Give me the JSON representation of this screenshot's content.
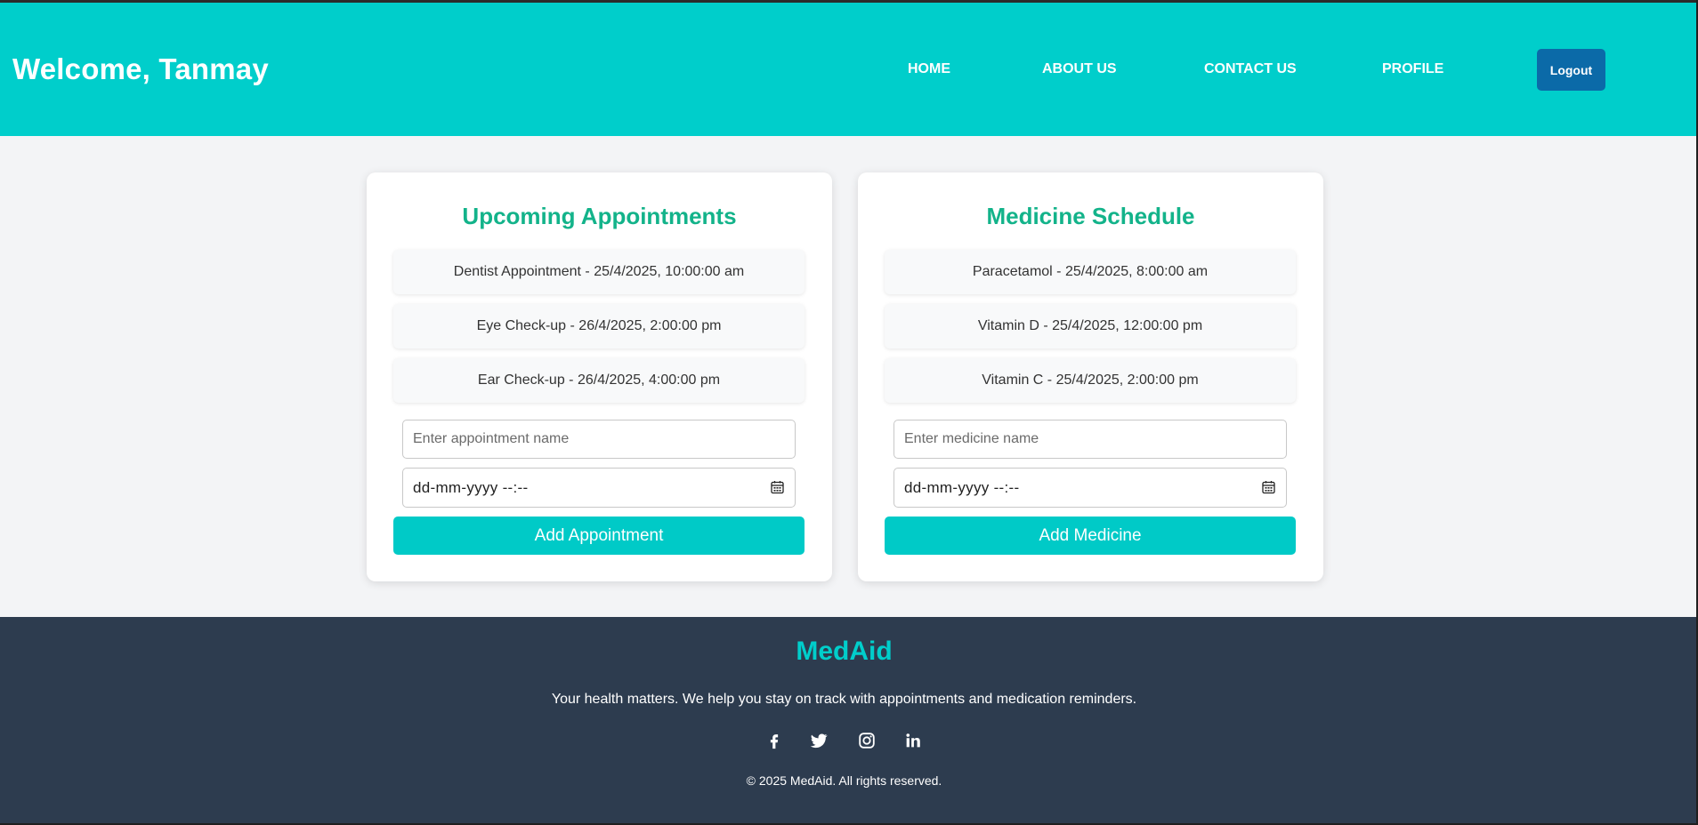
{
  "header": {
    "welcome": "Welcome, Tanmay",
    "nav": {
      "home": "HOME",
      "about": "ABOUT US",
      "contact": "CONTACT US",
      "profile": "PROFILE"
    },
    "logout_label": "Logout"
  },
  "appointments": {
    "title": "Upcoming Appointments",
    "items": [
      "Dentist Appointment - 25/4/2025, 10:00:00 am",
      "Eye Check-up - 26/4/2025, 2:00:00 pm",
      "Ear Check-up - 26/4/2025, 4:00:00 pm"
    ],
    "name_placeholder": "Enter appointment name",
    "name_value": "",
    "date_placeholder": "dd-mm-yyyy --:--",
    "button_label": "Add Appointment"
  },
  "medicines": {
    "title": "Medicine Schedule",
    "items": [
      "Paracetamol - 25/4/2025, 8:00:00 am",
      "Vitamin D - 25/4/2025, 12:00:00 pm",
      "Vitamin C - 25/4/2025, 2:00:00 pm"
    ],
    "name_placeholder": "Enter medicine name",
    "name_value": "",
    "date_placeholder": "dd-mm-yyyy --:--",
    "button_label": "Add Medicine"
  },
  "footer": {
    "brand": "MedAid",
    "tagline": "Your health matters. We help you stay on track with appointments and medication reminders.",
    "socials": [
      "facebook-icon",
      "twitter-icon",
      "instagram-icon",
      "linkedin-icon"
    ],
    "copyright": "© 2025 MedAid. All rights reserved."
  },
  "colors": {
    "header_bg": "#00cecb",
    "accent_title": "#13b38a",
    "logout_bg": "#0b6aa8",
    "button_bg": "#00cac7",
    "footer_bg": "#2d3c4f",
    "page_bg": "#f3f4f6"
  }
}
